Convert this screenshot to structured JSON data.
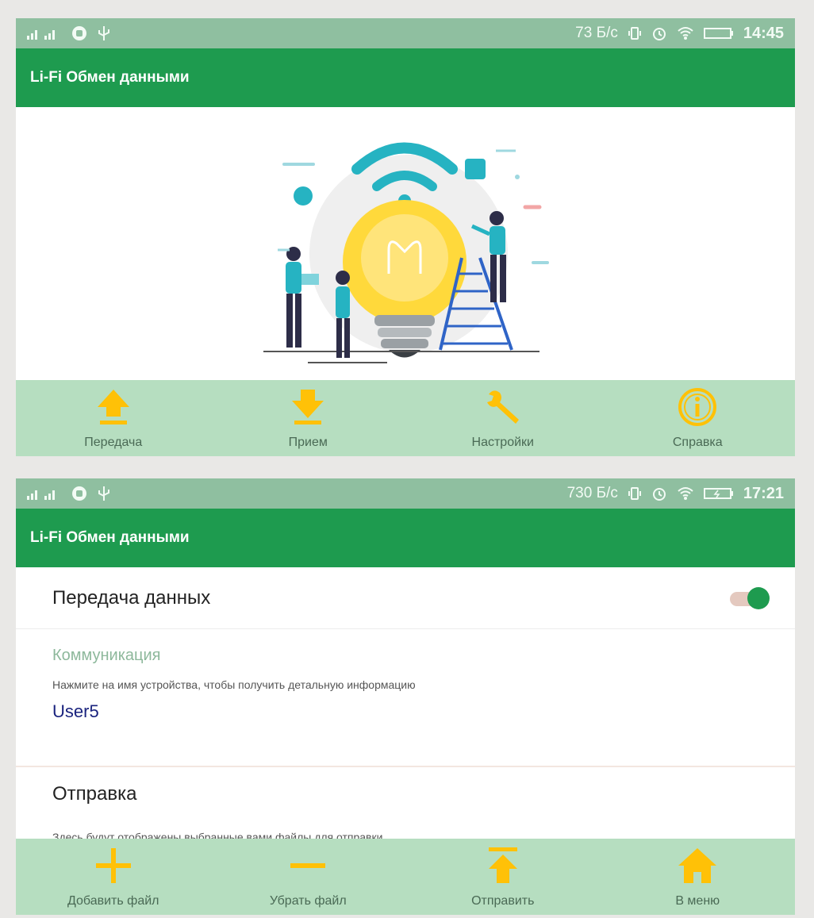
{
  "screens": [
    {
      "status": {
        "net_speed": "73 Б/с",
        "time": "14:45"
      },
      "app_title": "Li-Fi  Обмен данными",
      "nav": [
        {
          "label": "Передача",
          "icon": "upload-arrow-icon"
        },
        {
          "label": "Прием",
          "icon": "download-arrow-icon"
        },
        {
          "label": "Настройки",
          "icon": "wrench-icon"
        },
        {
          "label": "Справка",
          "icon": "info-circle-icon"
        }
      ]
    },
    {
      "status": {
        "net_speed": "730 Б/с",
        "time": "17:21"
      },
      "app_title": "Li-Fi  Обмен данными",
      "transfer": {
        "label": "Передача данных",
        "enabled": true
      },
      "communication": {
        "header": "Коммуникация",
        "description": "Нажмите на имя устройства, чтобы получить детальную информацию",
        "device": "User5"
      },
      "send": {
        "header": "Отправка",
        "description": "Здесь будут отображены выбранные вами файлы для отправки"
      },
      "nav": [
        {
          "label": "Добавить файл",
          "icon": "plus-icon"
        },
        {
          "label": "Убрать файл",
          "icon": "minus-icon"
        },
        {
          "label": "Отправить",
          "icon": "send-arrow-icon"
        },
        {
          "label": "В меню",
          "icon": "home-icon"
        }
      ]
    }
  ],
  "colors": {
    "statusbar": "#8fbfa0",
    "appbar": "#1e9b4f",
    "bottomnav": "#b6dec0",
    "icon_yellow": "#ffc107",
    "link_blue": "#1a237e"
  }
}
